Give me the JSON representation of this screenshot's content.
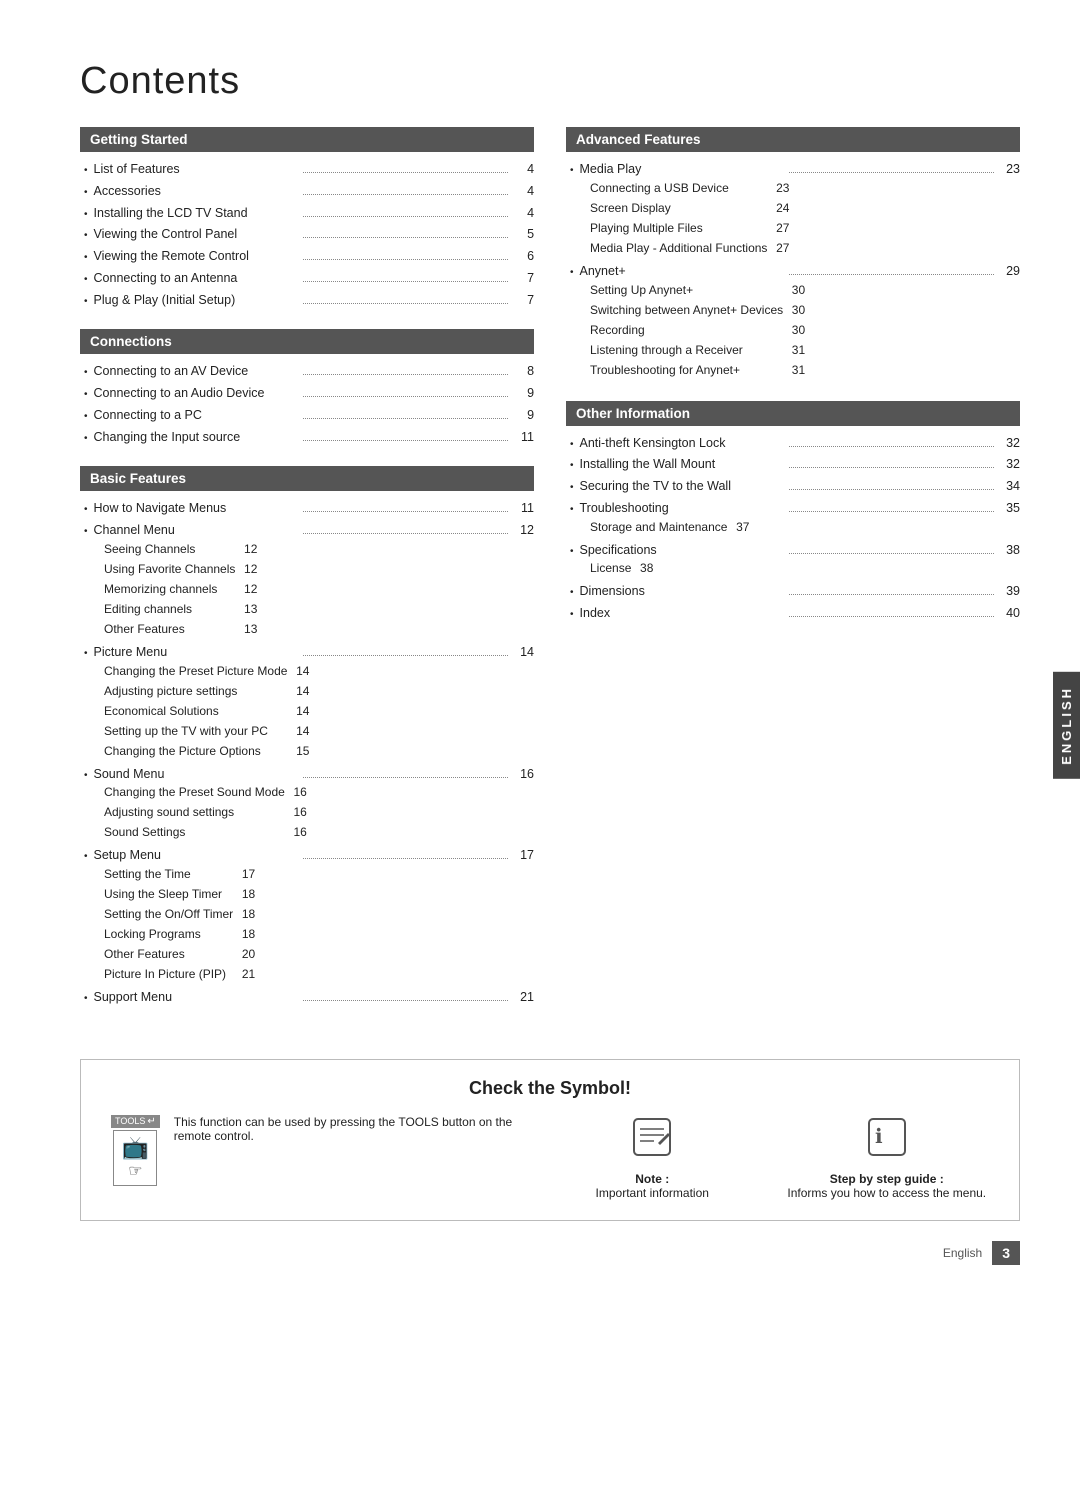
{
  "page": {
    "title": "Contents",
    "footer_lang": "English",
    "footer_page": "3"
  },
  "english_tab": "ENGLISH",
  "sections": {
    "getting_started": {
      "header": "Getting Started",
      "items": [
        {
          "text": "List of Features",
          "page": "4"
        },
        {
          "text": "Accessories",
          "page": "4"
        },
        {
          "text": "Installing the LCD TV Stand",
          "page": "4"
        },
        {
          "text": "Viewing the Control Panel",
          "page": "5"
        },
        {
          "text": "Viewing the Remote Control",
          "page": "6"
        },
        {
          "text": "Connecting to an Antenna",
          "page": "7"
        },
        {
          "text": "Plug & Play (Initial Setup)",
          "page": "7"
        }
      ]
    },
    "connections": {
      "header": "Connections",
      "items": [
        {
          "text": "Connecting to an AV Device",
          "page": "8"
        },
        {
          "text": "Connecting to an Audio Device",
          "page": "9"
        },
        {
          "text": "Connecting to a PC",
          "page": "9"
        },
        {
          "text": "Changing the Input source",
          "page": "11"
        }
      ]
    },
    "basic_features": {
      "header": "Basic Features",
      "items": [
        {
          "text": "How to Navigate Menus",
          "page": "11",
          "sub": []
        },
        {
          "text": "Channel Menu",
          "page": "12",
          "sub": [
            {
              "text": "Seeing Channels",
              "page": "12"
            },
            {
              "text": "Using Favorite Channels",
              "page": "12"
            },
            {
              "text": "Memorizing channels",
              "page": "12"
            },
            {
              "text": "Editing channels",
              "page": "13"
            },
            {
              "text": "Other Features",
              "page": "13"
            }
          ]
        },
        {
          "text": "Picture Menu",
          "page": "14",
          "sub": [
            {
              "text": "Changing the Preset Picture Mode",
              "page": "14"
            },
            {
              "text": "Adjusting picture settings",
              "page": "14"
            },
            {
              "text": "Economical Solutions",
              "page": "14"
            },
            {
              "text": "Setting up the TV with your PC",
              "page": "14"
            },
            {
              "text": "Changing the Picture Options",
              "page": "15"
            }
          ]
        },
        {
          "text": "Sound Menu",
          "page": "16",
          "sub": [
            {
              "text": "Changing the Preset Sound Mode",
              "page": "16"
            },
            {
              "text": "Adjusting sound settings",
              "page": "16"
            },
            {
              "text": "Sound Settings",
              "page": "16"
            }
          ]
        },
        {
          "text": "Setup Menu",
          "page": "17",
          "sub": [
            {
              "text": "Setting the Time",
              "page": "17"
            },
            {
              "text": "Using the Sleep Timer",
              "page": "18"
            },
            {
              "text": "Setting the On/Off Timer",
              "page": "18"
            },
            {
              "text": "Locking Programs",
              "page": "18"
            },
            {
              "text": "Other Features",
              "page": "20"
            },
            {
              "text": "Picture In Picture (PIP)",
              "page": "21"
            }
          ]
        },
        {
          "text": "Support Menu",
          "page": "21",
          "sub": []
        }
      ]
    },
    "advanced_features": {
      "header": "Advanced Features",
      "items": [
        {
          "text": "Media Play",
          "page": "23",
          "sub": [
            {
              "text": "Connecting a USB Device",
              "page": "23"
            },
            {
              "text": "Screen Display",
              "page": "24"
            },
            {
              "text": "Playing Multiple Files",
              "page": "27"
            },
            {
              "text": "Media Play - Additional Functions",
              "page": "27"
            }
          ]
        },
        {
          "text": "Anynet+",
          "page": "29",
          "sub": [
            {
              "text": "Setting Up Anynet+",
              "page": "30"
            },
            {
              "text": "Switching between Anynet+ Devices",
              "page": "30"
            },
            {
              "text": "Recording",
              "page": "30"
            },
            {
              "text": "Listening through a Receiver",
              "page": "31"
            },
            {
              "text": "Troubleshooting for Anynet+",
              "page": "31"
            }
          ]
        }
      ]
    },
    "other_information": {
      "header": "Other Information",
      "items": [
        {
          "text": "Anti-theft Kensington Lock",
          "page": "32",
          "sub": []
        },
        {
          "text": "Installing the Wall Mount",
          "page": "32",
          "sub": []
        },
        {
          "text": "Securing the TV to the Wall",
          "page": "34",
          "sub": []
        },
        {
          "text": "Troubleshooting",
          "page": "35",
          "sub": [
            {
              "text": "Storage and Maintenance",
              "page": "37"
            }
          ]
        },
        {
          "text": "Specifications",
          "page": "38",
          "sub": [
            {
              "text": "License",
              "page": "38"
            }
          ]
        },
        {
          "text": "Dimensions",
          "page": "39",
          "sub": []
        },
        {
          "text": "Index",
          "page": "40",
          "sub": []
        }
      ]
    }
  },
  "check_symbol": {
    "title": "Check the Symbol!",
    "tools_label": "TOOLS",
    "tools_arrow": "↵",
    "tools_desc": "This function can be used by pressing the TOOLS button on the remote control.",
    "note_label": "Note :",
    "note_desc": "Important information",
    "guide_label": "Step by step guide :",
    "guide_desc": "Informs you how to access the menu."
  }
}
